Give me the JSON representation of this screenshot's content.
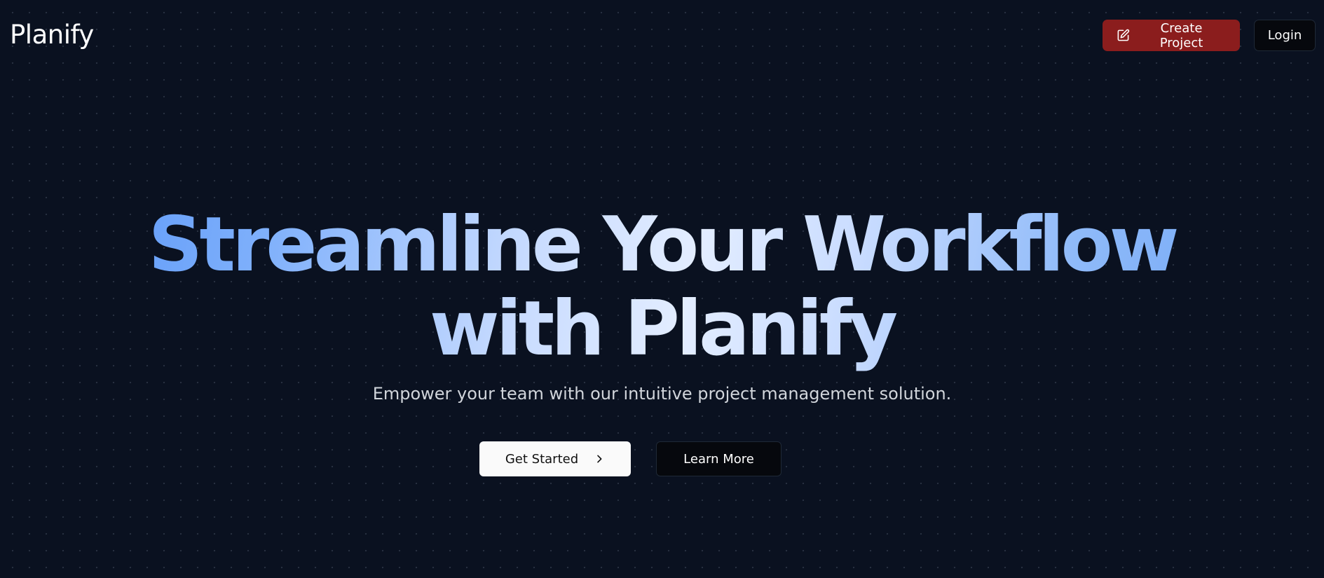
{
  "brand": {
    "name": "Planify"
  },
  "nav": {
    "create_label": "Create Project",
    "create_icon": "edit-icon",
    "login_label": "Login"
  },
  "hero": {
    "title_line1": "Streamline Your Workflow",
    "title_line2": "with Planify",
    "subtitle": "Empower your team with our intuitive project management solution.",
    "primary_label": "Get Started",
    "primary_icon": "chevron-right-icon",
    "secondary_label": "Learn More"
  },
  "colors": {
    "background": "#0a1120",
    "create_button": "#8b1d1d",
    "title_gradient_start": "#4f8ff7",
    "title_gradient_end": "#e3edff"
  }
}
